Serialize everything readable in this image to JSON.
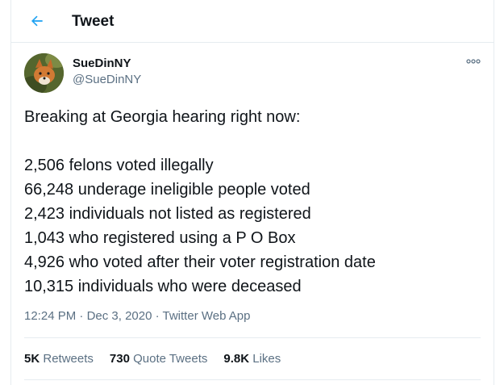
{
  "header": {
    "title": "Tweet",
    "back_icon": "back-arrow-icon",
    "accent": "#1da1f2"
  },
  "author": {
    "name": "SueDinNY",
    "handle": "@SueDinNY"
  },
  "tweet": {
    "lines": [
      "Breaking at Georgia hearing right now:",
      "",
      "2,506 felons voted illegally",
      "66,248 underage ineligible people voted",
      "2,423 individuals not listed as registered",
      "1,043 who registered using a P O Box",
      "4,926 who voted after their voter registration date",
      "10,315 individuals who were deceased"
    ]
  },
  "meta": {
    "time": "12:24 PM",
    "sep": " · ",
    "date": "Dec 3, 2020",
    "source": "Twitter Web App"
  },
  "stats": {
    "retweets_count": "5K",
    "retweets_label": "Retweets",
    "quotes_count": "730",
    "quotes_label": "Quote Tweets",
    "likes_count": "9.8K",
    "likes_label": "Likes"
  }
}
